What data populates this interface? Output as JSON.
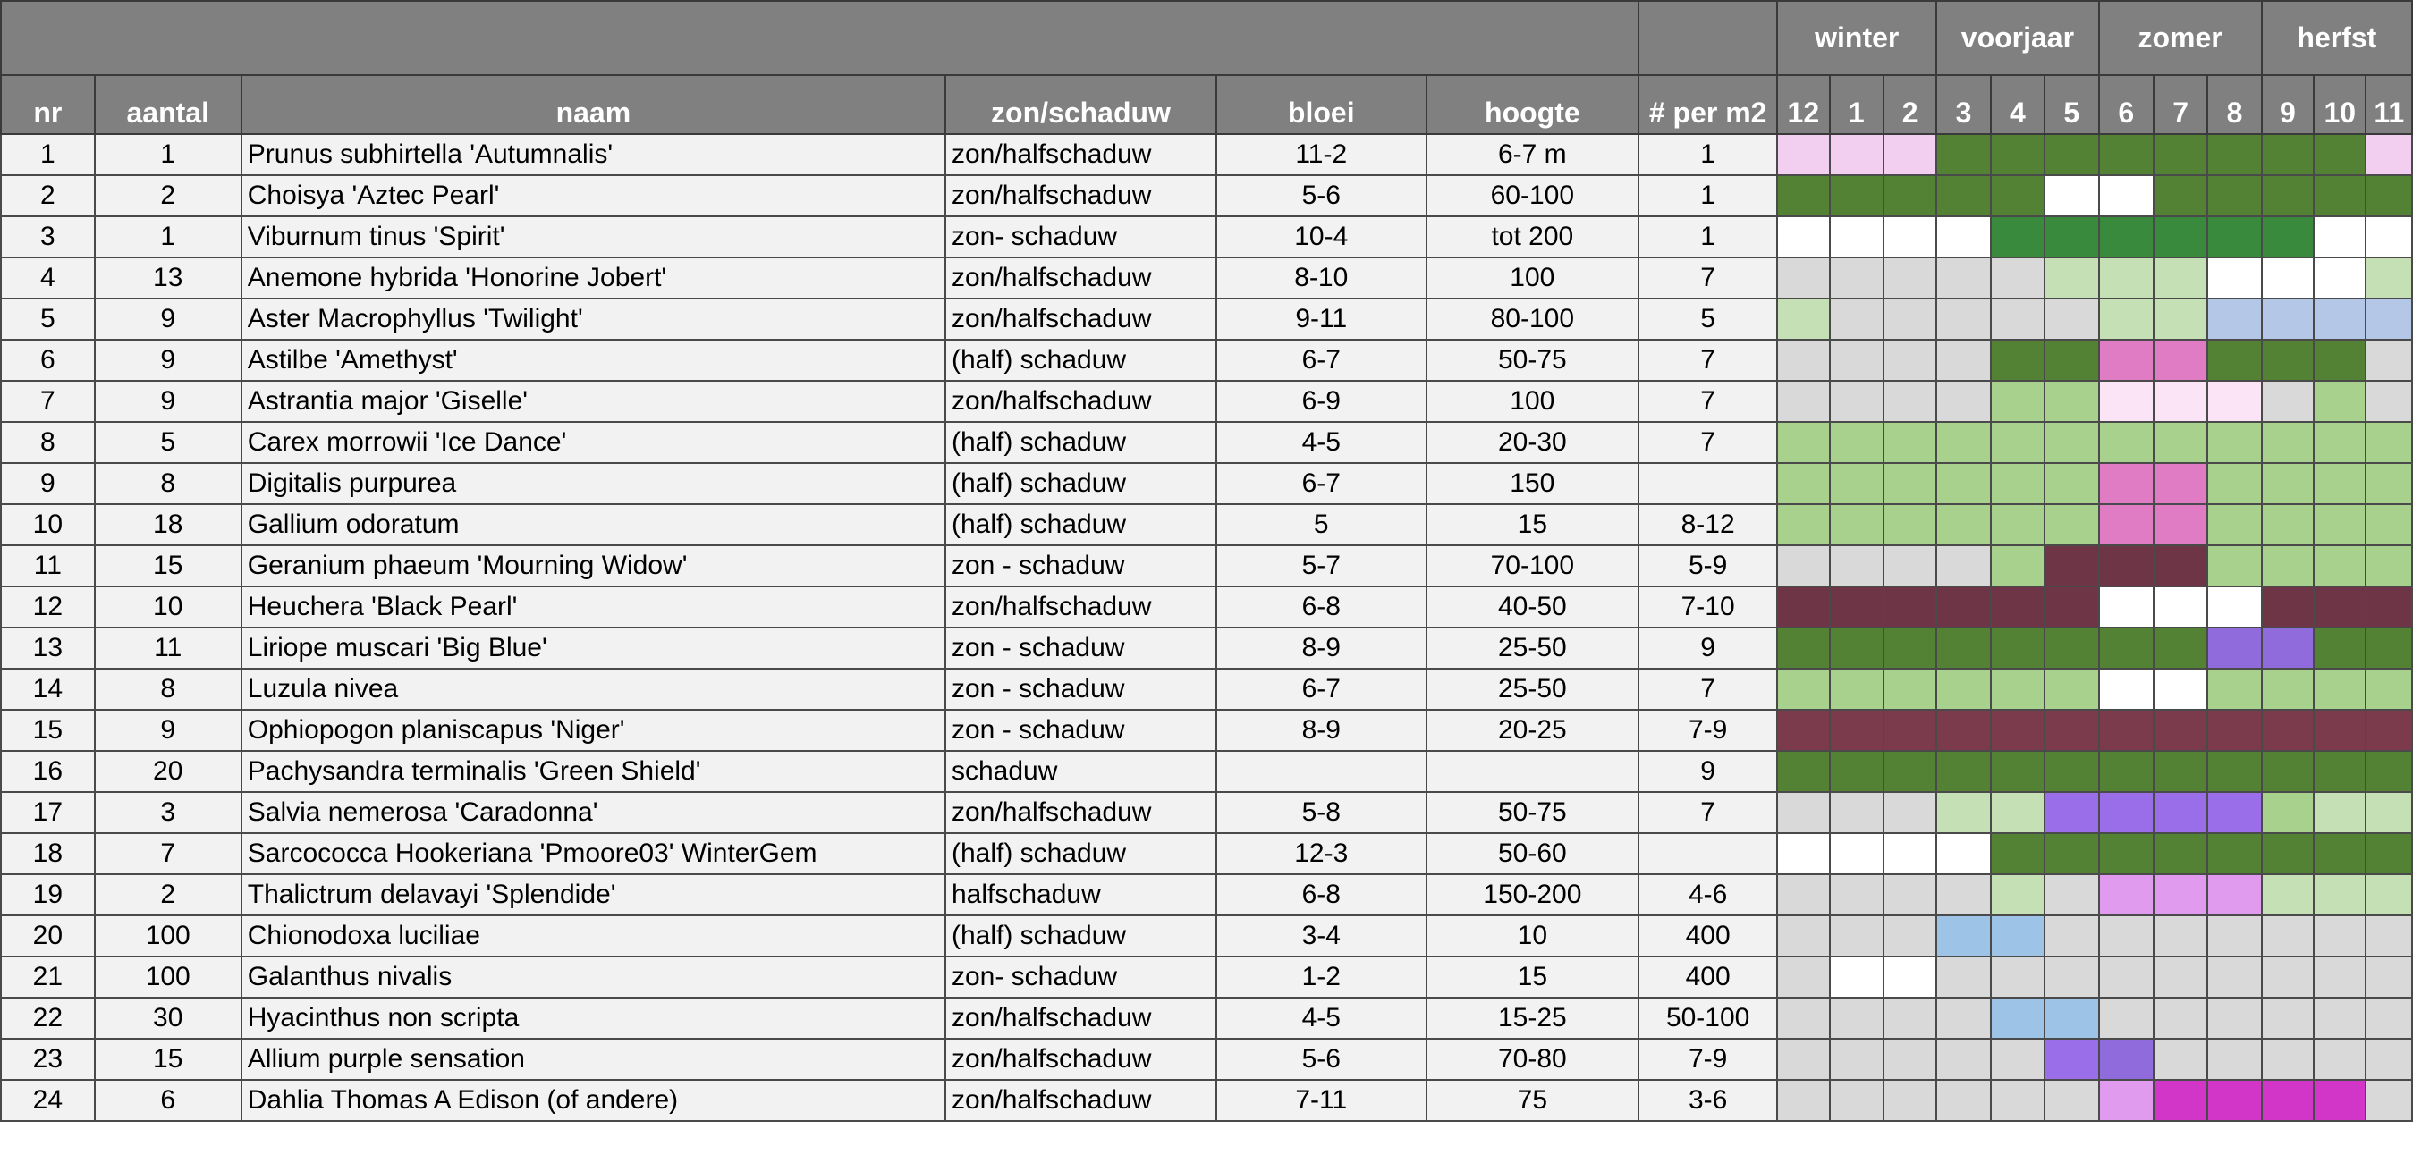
{
  "seasons": [
    {
      "label": "winter",
      "span": 3
    },
    {
      "label": "voorjaar",
      "span": 3
    },
    {
      "label": "zomer",
      "span": 3
    },
    {
      "label": "herfst",
      "span": 3
    }
  ],
  "columns": [
    "nr",
    "aantal",
    "naam",
    "zon/schaduw",
    "bloei",
    "hoogte",
    "# per m2"
  ],
  "months": [
    "12",
    "1",
    "2",
    "3",
    "4",
    "5",
    "6",
    "7",
    "8",
    "9",
    "10",
    "11"
  ],
  "colors": {
    "L": "#f2cef0",
    "G": "#548235",
    "V": "#3a8a3e",
    "W": "#ffffff",
    "g": "#d9d9d9",
    "l": "#c5e0b4",
    "a": "#a9d18e",
    "b": "#b4c7e7",
    "s": "#9dc3e6",
    "P": "#e07cc4",
    "p": "#fbe4f5",
    "D": "#6e3546",
    "d": "#7b3b4d",
    "U": "#8f6bdb",
    "u": "#9a6ee8",
    "r": "#e19bee",
    "M": "#d136c8"
  },
  "rows": [
    {
      "nr": "1",
      "aantal": "1",
      "naam": "Prunus subhirtella 'Autumnalis'",
      "zon": "zon/halfschaduw",
      "bloei": "11-2",
      "hoogte": "6-7 m",
      "per_m2": "1",
      "months": "LLLGGGGGGGGL"
    },
    {
      "nr": "2",
      "aantal": "2",
      "naam": "Choisya 'Aztec Pearl'",
      "zon": "zon/halfschaduw",
      "bloei": "5-6",
      "hoogte": "60-100",
      "per_m2": "1",
      "months": "GGGGGWWGGGGG"
    },
    {
      "nr": "3",
      "aantal": "1",
      "naam": "Viburnum tinus 'Spirit'",
      "zon": "zon- schaduw",
      "bloei": "10-4",
      "hoogte": "tot 200",
      "per_m2": "1",
      "months": "WWWWVVVVVVWW"
    },
    {
      "nr": "4",
      "aantal": "13",
      "naam": "Anemone hybrida 'Honorine Jobert'",
      "zon": "zon/halfschaduw",
      "bloei": "8-10",
      "hoogte": "100",
      "per_m2": "7",
      "months": "ggggglllWWWl"
    },
    {
      "nr": "5",
      "aantal": "9",
      "naam": "Aster Macrophyllus 'Twilight'",
      "zon": "zon/halfschaduw",
      "bloei": "9-11",
      "hoogte": "80-100",
      "per_m2": "5",
      "months": "lgggggllbbbb"
    },
    {
      "nr": "6",
      "aantal": "9",
      "naam": "Astilbe 'Amethyst'",
      "zon": "(half) schaduw",
      "bloei": "6-7",
      "hoogte": "50-75",
      "per_m2": "7",
      "months": "ggggGGPPGGGg"
    },
    {
      "nr": "7",
      "aantal": "9",
      "naam": "Astrantia major 'Giselle'",
      "zon": "zon/halfschaduw",
      "bloei": "6-9",
      "hoogte": "100",
      "per_m2": "7",
      "months": "ggggaapppmag"
    },
    {
      "nr": "8",
      "aantal": "5",
      "naam": "Carex morrowii 'Ice Dance'",
      "zon": "(half) schaduw",
      "bloei": "4-5",
      "hoogte": "20-30",
      "per_m2": "7",
      "months": "aaaaaaaaaaaa"
    },
    {
      "nr": "9",
      "aantal": "8",
      "naam": "Digitalis purpurea",
      "zon": "(half) schaduw",
      "bloei": "6-7",
      "hoogte": "150",
      "per_m2": "",
      "months": "aaaaaaPPaaaa"
    },
    {
      "nr": "10",
      "aantal": "18",
      "naam": "Gallium odoratum",
      "zon": "(half) schaduw",
      "bloei": "5",
      "hoogte": "15",
      "per_m2": "8-12",
      "months": "aaaaaaPPaaaa"
    },
    {
      "nr": "11",
      "aantal": "15",
      "naam": "Geranium phaeum 'Mourning Widow'",
      "zon": "zon - schaduw",
      "bloei": "5-7",
      "hoogte": "70-100",
      "per_m2": "5-9",
      "months": "ggggaDDDaaaa"
    },
    {
      "nr": "12",
      "aantal": "10",
      "naam": "Heuchera 'Black Pearl'",
      "zon": "zon/halfschaduw",
      "bloei": "6-8",
      "hoogte": "40-50",
      "per_m2": "7-10",
      "months": "DDDDDDWWWDDD"
    },
    {
      "nr": "13",
      "aantal": "11",
      "naam": "Liriope muscari 'Big Blue'",
      "zon": "zon - schaduw",
      "bloei": "8-9",
      "hoogte": "25-50",
      "per_m2": "9",
      "months": "GGGGGGGGUUGG"
    },
    {
      "nr": "14",
      "aantal": "8",
      "naam": "Luzula nivea",
      "zon": "zon - schaduw",
      "bloei": "6-7",
      "hoogte": "25-50",
      "per_m2": "7",
      "months": "aaaaaaWWaaaa"
    },
    {
      "nr": "15",
      "aantal": "9",
      "naam": "Ophiopogon planiscapus 'Niger'",
      "zon": "zon - schaduw",
      "bloei": "8-9",
      "hoogte": "20-25",
      "per_m2": "7-9",
      "months": "dddddddddddd"
    },
    {
      "nr": "16",
      "aantal": "20",
      "naam": "Pachysandra terminalis 'Green Shield'",
      "zon": "schaduw",
      "bloei": "",
      "hoogte": "",
      "per_m2": "9",
      "months": "GGGGGGGGGGGG"
    },
    {
      "nr": "17",
      "aantal": "3",
      "naam": "Salvia nemerosa 'Caradonna'",
      "zon": "zon/halfschaduw",
      "bloei": "5-8",
      "hoogte": "50-75",
      "per_m2": "7",
      "months": "ggglluuuuall"
    },
    {
      "nr": "18",
      "aantal": "7",
      "naam": "Sarcococca Hookeriana 'Pmoore03' WinterGem",
      "zon": "(half) schaduw",
      "bloei": "12-3",
      "hoogte": "50-60",
      "per_m2": "",
      "months": "WWWWGGGGGGGG"
    },
    {
      "nr": "19",
      "aantal": "2",
      "naam": "Thalictrum delavayi 'Splendide'",
      "zon": "halfschaduw",
      "bloei": "6-8",
      "hoogte": "150-200",
      "per_m2": "4-6",
      "months": "gggglmrrrlll"
    },
    {
      "nr": "20",
      "aantal": "100",
      "naam": "Chionodoxa luciliae",
      "zon": "(half) schaduw",
      "bloei": "3-4",
      "hoogte": "10",
      "per_m2": "400",
      "months": "gggssggggggg"
    },
    {
      "nr": "21",
      "aantal": "100",
      "naam": "Galanthus nivalis",
      "zon": "zon- schaduw",
      "bloei": "1-2",
      "hoogte": "15",
      "per_m2": "400",
      "months": "gWWggggggggg"
    },
    {
      "nr": "22",
      "aantal": "30",
      "naam": "Hyacinthus non scripta",
      "zon": "zon/halfschaduw",
      "bloei": "4-5",
      "hoogte": "15-25",
      "per_m2": "50-100",
      "months": "ggggssgggggg"
    },
    {
      "nr": "23",
      "aantal": "15",
      "naam": "Allium purple sensation",
      "zon": "zon/halfschaduw",
      "bloei": "5-6",
      "hoogte": "70-80",
      "per_m2": "7-9",
      "months": "ggggguUggggg"
    },
    {
      "nr": "24",
      "aantal": "6",
      "naam": "Dahlia Thomas A Edison (of andere)",
      "zon": "zon/halfschaduw",
      "bloei": "7-11",
      "hoogte": "75",
      "per_m2": "3-6",
      "months": "ggggggrMMMMg"
    }
  ]
}
